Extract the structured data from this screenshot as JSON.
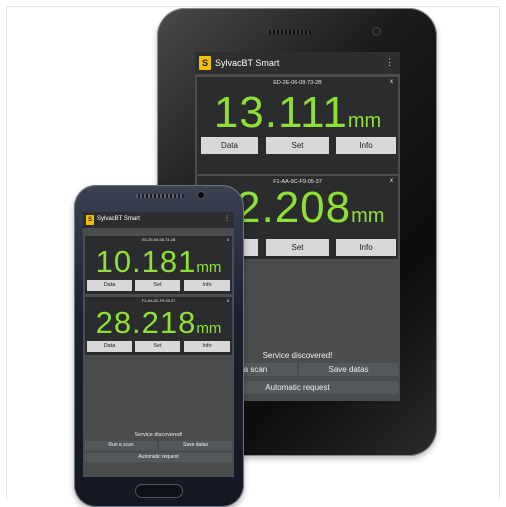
{
  "app": {
    "title": "SylvacBT Smart",
    "logo_text": "S",
    "overflow_icon": "⋮",
    "accent_color": "#8fe034"
  },
  "tablet": {
    "devices": [
      {
        "address": "ED-2E-06-08-73-2B",
        "value": "13.111",
        "unit": "mm",
        "close": "x"
      },
      {
        "address": "F1-AA-9C-F9-05-37",
        "value": "12.208",
        "unit": "mm",
        "close": "x"
      }
    ],
    "status": "Service discovered!",
    "buttons": {
      "data": "Data",
      "set": "Set",
      "info": "Info"
    },
    "run_scan": "Run a scan",
    "save_datas": "Save datas",
    "automatic_request": "Automatic request"
  },
  "phone": {
    "devices": [
      {
        "address": "ED-2E-06-08-73-2B",
        "value": "10.181",
        "unit": "mm",
        "close": "x"
      },
      {
        "address": "F1-AA-9C-F9-05-37",
        "value": "28.218",
        "unit": "mm",
        "close": "x"
      }
    ],
    "status": "Service discovered!",
    "buttons": {
      "data": "Data",
      "set": "Set",
      "info": "Info"
    },
    "run_scan": "Run a scan",
    "save_datas": "Save datas",
    "automatic_request": "Automatic request"
  }
}
